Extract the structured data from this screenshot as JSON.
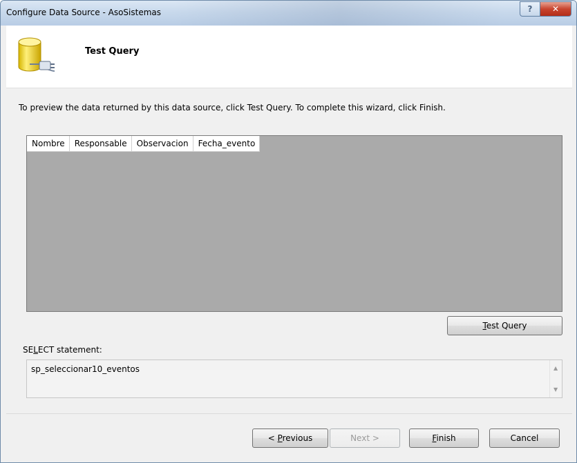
{
  "window": {
    "title": "Configure Data Source - AsoSistemas",
    "help_label": "?",
    "close_label": "✕"
  },
  "header": {
    "title": "Test Query",
    "icon": "database-connection-icon"
  },
  "instructions": "To preview the data returned by this data source, click Test Query. To complete this wizard, click Finish.",
  "grid": {
    "columns": [
      "Nombre",
      "Responsable",
      "Observacion",
      "Fecha_evento"
    ],
    "rows": []
  },
  "test_query": {
    "label": "Test Query",
    "mnemonic": "T",
    "rest": "est Query"
  },
  "select": {
    "label": "SELECT statement:",
    "label_pre": "SE",
    "label_mnemonic": "L",
    "label_post": "ECT statement:",
    "value": "sp_seleccionar10_eventos"
  },
  "buttons": {
    "previous": {
      "prefix": "< ",
      "mnemonic": "P",
      "rest": "revious",
      "full": "< Previous"
    },
    "next": {
      "label": "Next >",
      "enabled": false
    },
    "finish": {
      "mnemonic": "F",
      "rest": "inish",
      "full": "Finish"
    },
    "cancel": {
      "label": "Cancel"
    }
  },
  "colors": {
    "grid_bg": "#aaaaaa",
    "title_bar": "#c8d9ec",
    "close_red": "#c8452f"
  }
}
